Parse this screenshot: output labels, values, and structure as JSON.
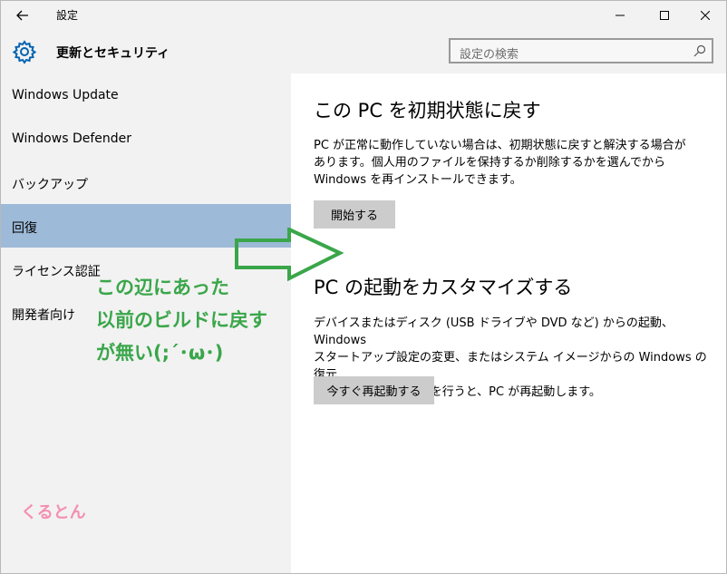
{
  "window": {
    "title": "設定"
  },
  "header": {
    "title": "更新とセキュリティ",
    "search_placeholder": "設定の検索"
  },
  "sidebar": {
    "items": [
      {
        "label": "Windows Update",
        "selected": false
      },
      {
        "label": "Windows Defender",
        "selected": false
      },
      {
        "label": "バックアップ",
        "selected": false
      },
      {
        "label": "回復",
        "selected": true
      },
      {
        "label": "ライセンス認証",
        "selected": false
      },
      {
        "label": "開発者向け",
        "selected": false
      }
    ]
  },
  "main": {
    "reset": {
      "title": "この PC を初期状態に戻す",
      "description_lines": [
        "PC が正常に動作していない場合は、初期状態に戻すと解決する場合が",
        "あります。個人用のファイルを保持するか削除するかを選んでから",
        "Windows を再インストールできます。"
      ],
      "button": "開始する"
    },
    "startup": {
      "title": "PC の起動をカスタマイズする",
      "description_lines": [
        "デバイスまたはディスク (USB ドライブや DVD など) からの起動、Windows",
        "スタートアップ設定の変更、またはシステム イメージからの Windows の復元",
        "を行います。この操作を行うと、PC が再起動します。"
      ],
      "button": "今すぐ再起動する"
    }
  },
  "annotation": {
    "lines": [
      "この辺にあった",
      "以前のビルドに戻す",
      "が無い(;´･ω･)"
    ],
    "signature": "くるとん",
    "colors": {
      "green": "#3aa64a",
      "pink": "#f48fb1"
    }
  },
  "colors": {
    "chrome": "#f2f2f2",
    "selected": "#9dbad8",
    "button": "#cccccc",
    "accent": "#0063b1"
  }
}
